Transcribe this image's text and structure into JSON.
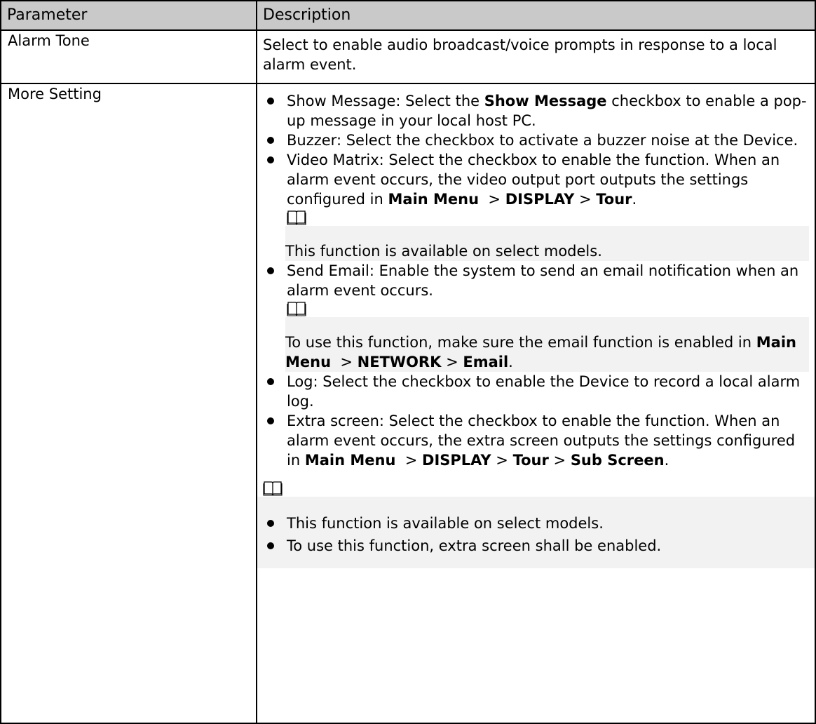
{
  "table": {
    "header": {
      "param": "Parameter",
      "desc": "Description"
    },
    "rows": [
      {
        "param": "Alarm Tone",
        "desc": "Select to enable audio broadcast/voice prompts in response to a local alarm event."
      },
      {
        "param": "More Setting",
        "items": [
          {
            "pre": "Show Message: Select the ",
            "bold": "Show Message",
            "post": "  checkbox to enable a pop-up message in your local host PC."
          },
          {
            "text": "Buzzer: Select the checkbox to activate a buzzer noise at the Device."
          },
          {
            "text": "Video Matrix: Select the checkbox to enable the function. When an alarm event occurs, the video output port outputs the settings configured in ",
            "path": [
              "Main Menu",
              "DISPLAY",
              "Tour"
            ],
            "note": "This function is available on select models."
          },
          {
            "text": "Send Email: Enable the system to send an email notification when an alarm event occurs.",
            "note_pre": "To use this function, make sure the email function is enabled in ",
            "note_path": [
              "Main Menu",
              "NETWORK",
              "Email"
            ]
          },
          {
            "text": "Log: Select the checkbox to enable the Device to record a local alarm log."
          },
          {
            "text": "Extra screen: Select the checkbox to enable the function. When an alarm event occurs, the extra screen outputs the settings configured in ",
            "path": [
              "Main Menu",
              "DISPLAY",
              "Tour",
              "Sub Screen"
            ]
          }
        ],
        "notes": [
          "This function is available on select models.",
          "To use this function, extra screen shall be enabled."
        ]
      }
    ]
  },
  "icons": {
    "note": "book-note-icon"
  }
}
